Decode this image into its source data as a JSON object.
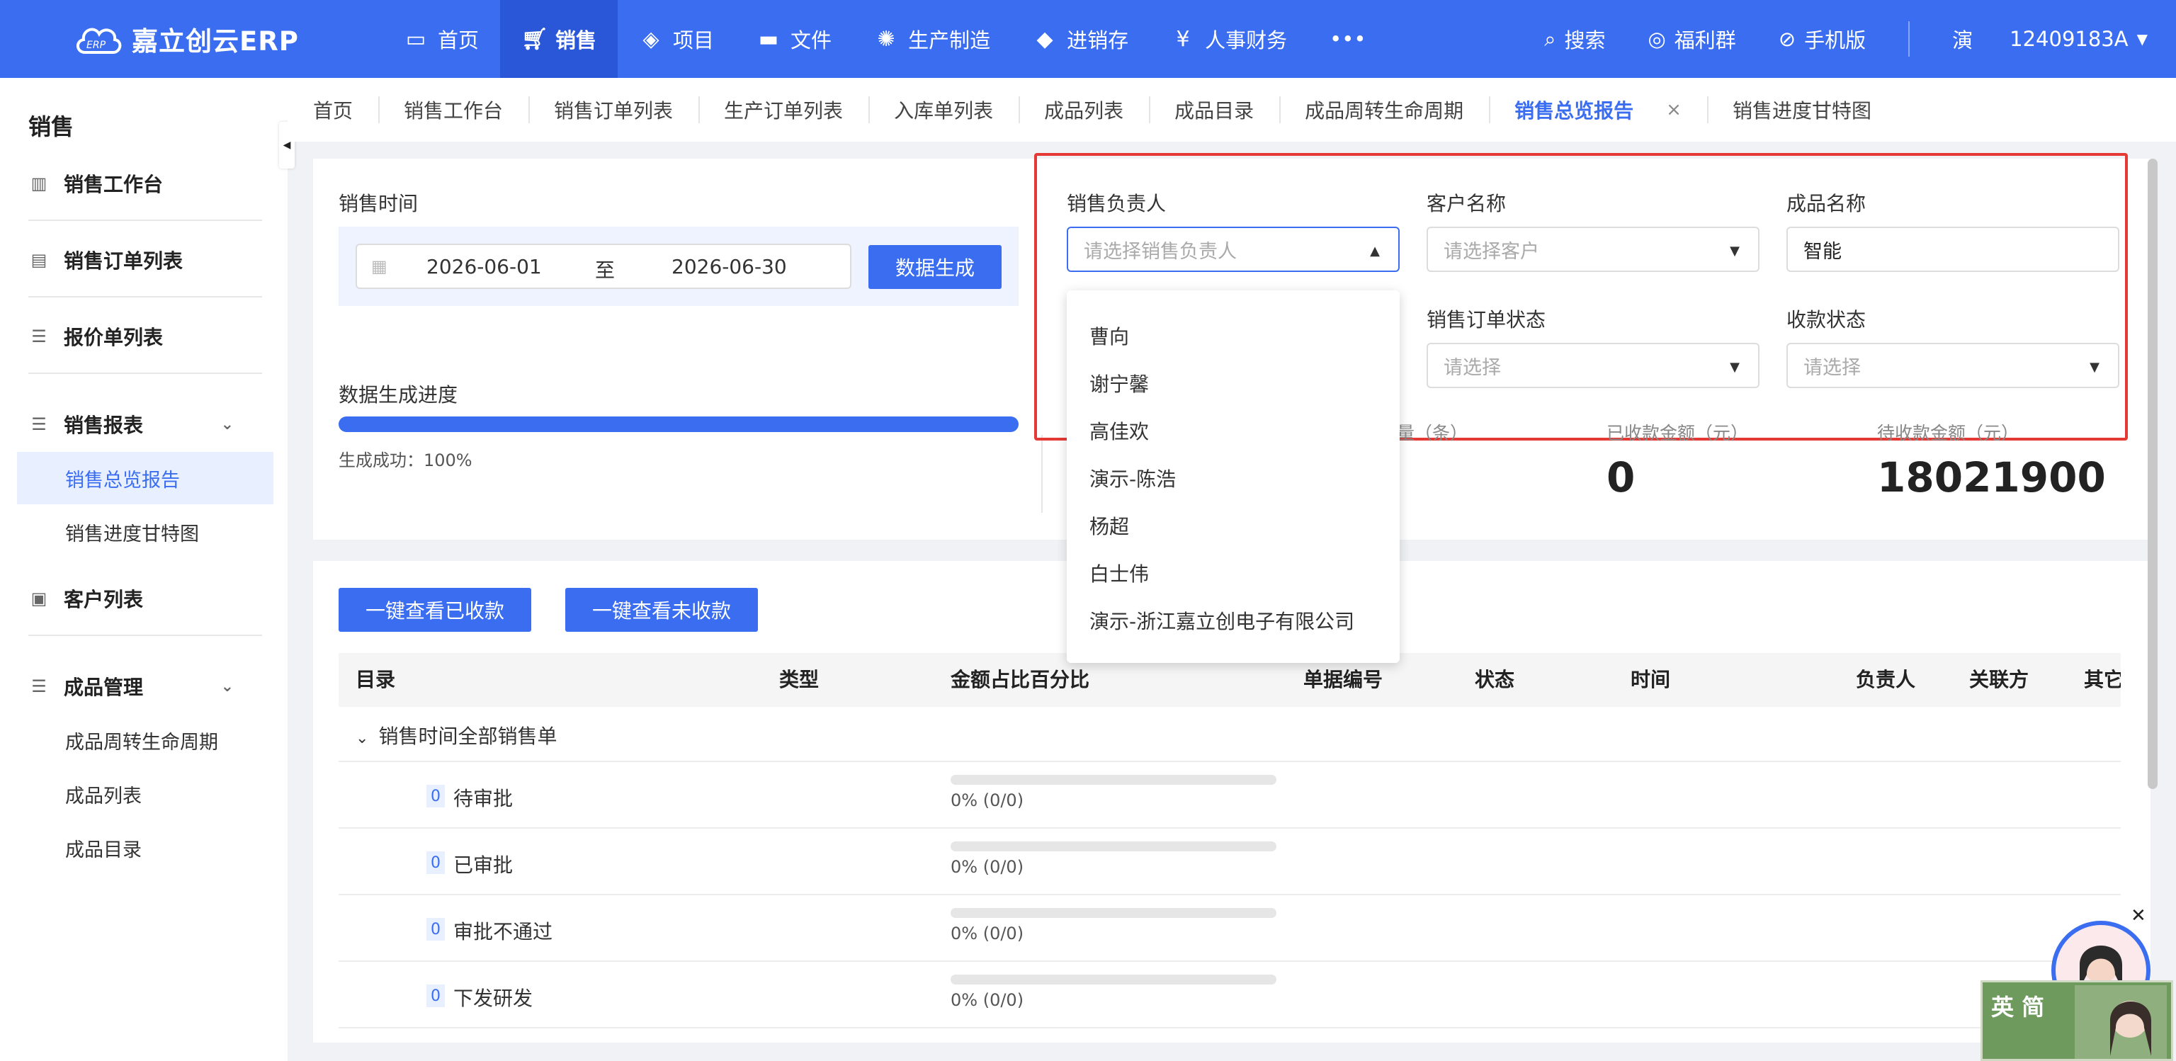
{
  "app": {
    "logo_text": "嘉立创云ERP",
    "logo_badge": "ERP"
  },
  "nav": [
    {
      "label": "首页",
      "icon": "monitor-icon"
    },
    {
      "label": "销售",
      "icon": "cart-icon",
      "active": true
    },
    {
      "label": "项目",
      "icon": "layers-icon"
    },
    {
      "label": "文件",
      "icon": "folder-icon"
    },
    {
      "label": "生产制造",
      "icon": "gear-icon"
    },
    {
      "label": "进销存",
      "icon": "box-icon"
    },
    {
      "label": "人事财务",
      "icon": "yen-icon"
    },
    {
      "label": "•••",
      "icon": "more-icon"
    }
  ],
  "topright": {
    "search": "搜索",
    "group": "福利群",
    "mobile": "手机版",
    "user_initial": "演",
    "user_id": "12409183A"
  },
  "sidebar": {
    "title": "销售",
    "items": [
      "销售工作台",
      "销售订单列表",
      "报价单列表",
      "销售报表",
      "客户列表",
      "成品管理"
    ],
    "report_sub": [
      "销售总览报告",
      "销售进度甘特图"
    ],
    "product_sub": [
      "成品周转生命周期",
      "成品列表",
      "成品目录"
    ]
  },
  "tabs": [
    "首页",
    "销售工作台",
    "销售订单列表",
    "生产订单列表",
    "入库单列表",
    "成品列表",
    "成品目录",
    "成品周转生命周期",
    "销售总览报告",
    "销售进度甘特图"
  ],
  "tab_close": "×",
  "filters": {
    "sale_time_label": "销售时间",
    "date_start": "2026-06-01",
    "date_to": "至",
    "date_end": "2026-06-30",
    "generate_button": "数据生成",
    "progress_label": "数据生成进度",
    "progress_text": "生成成功：100%",
    "progress_value": 100,
    "owner_label": "销售负责人",
    "owner_placeholder": "请选择销售负责人",
    "customer_label": "客户名称",
    "customer_placeholder": "请选择客户",
    "product_label": "成品名称",
    "product_value": "智能",
    "order_status_label": "销售订单状态",
    "order_status_placeholder": "请选择",
    "payment_status_label": "收款状态",
    "payment_status_placeholder": "请选择"
  },
  "dropdown_options": [
    "曹向",
    "谢宁馨",
    "高佳欢",
    "演示-陈浩",
    "杨超",
    "白士伟",
    "演示-浙江嘉立创电子有限公司"
  ],
  "stats": {
    "count_label_partial": "量（条）",
    "received_label": "已收款金额（元）",
    "received_value": "0",
    "pending_label": "待收款金额（元）",
    "pending_value": "18021900"
  },
  "actions": {
    "view_received": "一键查看已收款",
    "view_unreceived": "一键查看未收款"
  },
  "table": {
    "headers": [
      "目录",
      "类型",
      "金额占比百分比",
      "单据编号",
      "状态",
      "时间",
      "负责人",
      "关联方",
      "其它"
    ],
    "group": "销售时间全部销售单",
    "rows": [
      {
        "count": "0",
        "label": "待审批",
        "pct": "0% (0/0)"
      },
      {
        "count": "0",
        "label": "已审批",
        "pct": "0% (0/0)"
      },
      {
        "count": "0",
        "label": "审批不通过",
        "pct": "0% (0/0)"
      },
      {
        "count": "0",
        "label": "下发研发",
        "pct": "0% (0/0)"
      }
    ]
  },
  "ime": {
    "text": "英 简"
  },
  "colors": {
    "primary": "#3a6df0",
    "highlight_border": "#e53935"
  }
}
